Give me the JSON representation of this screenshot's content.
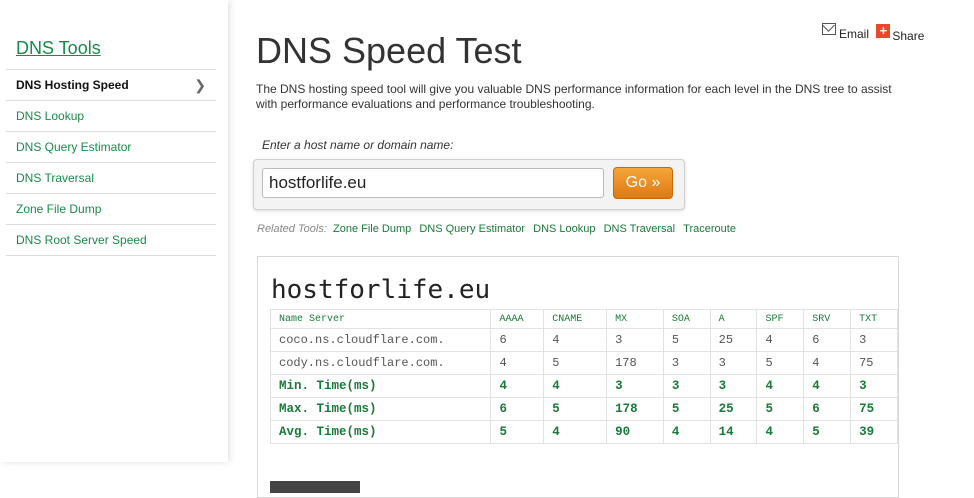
{
  "sidebar": {
    "title": "DNS Tools",
    "items": [
      {
        "label": "DNS Hosting Speed",
        "active": true
      },
      {
        "label": "DNS Lookup"
      },
      {
        "label": "DNS Query Estimator"
      },
      {
        "label": "DNS Traversal"
      },
      {
        "label": "Zone File Dump"
      },
      {
        "label": "DNS Root Server Speed"
      }
    ],
    "chevron": "❯"
  },
  "page": {
    "title": "DNS Speed Test",
    "description": "The DNS hosting speed tool will give you valuable DNS performance information for each level in the DNS tree to assist with performance evaluations and performance troubleshooting."
  },
  "share": {
    "email_label": "Email",
    "share_label": "Share",
    "email_icon": "envelope-icon",
    "share_icon": "plus-icon"
  },
  "form": {
    "label": "Enter a host name or domain name:",
    "value": "hostforlife.eu",
    "go_label": "Go »"
  },
  "related": {
    "prefix": "Related Tools:",
    "links": [
      "Zone File Dump",
      "DNS Query Estimator",
      "DNS Lookup",
      "DNS Traversal",
      "Traceroute"
    ]
  },
  "result": {
    "host": "hostforlife.eu",
    "columns": [
      "Name Server",
      "AAAA",
      "CNAME",
      "MX",
      "SOA",
      "A",
      "SPF",
      "SRV",
      "TXT"
    ],
    "rows": [
      [
        "coco.ns.cloudflare.com.",
        "6",
        "4",
        "3",
        "5",
        "25",
        "4",
        "6",
        "3"
      ],
      [
        "cody.ns.cloudflare.com.",
        "4",
        "5",
        "178",
        "3",
        "3",
        "5",
        "4",
        "75"
      ]
    ],
    "stats": [
      [
        "Min. Time(ms)",
        "4",
        "4",
        "3",
        "3",
        "3",
        "4",
        "4",
        "3"
      ],
      [
        "Max. Time(ms)",
        "6",
        "5",
        "178",
        "5",
        "25",
        "5",
        "6",
        "75"
      ],
      [
        "Avg. Time(ms)",
        "5",
        "4",
        "90",
        "4",
        "14",
        "4",
        "5",
        "39"
      ]
    ]
  },
  "colors": {
    "accent": "#1a8a4a",
    "button": "#e8891f",
    "share_red": "#e34b2a"
  }
}
